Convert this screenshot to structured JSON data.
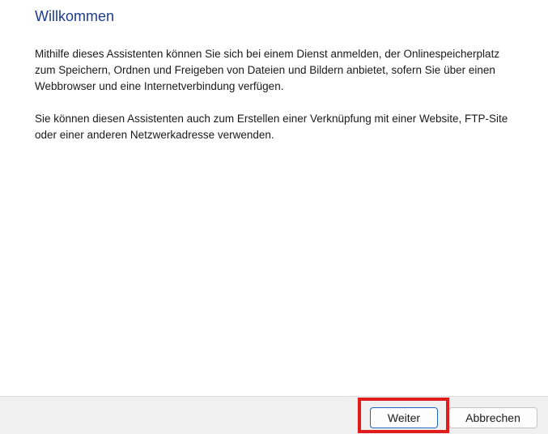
{
  "header": {
    "title": "Willkommen"
  },
  "main": {
    "paragraph1": "Mithilfe dieses Assistenten können Sie sich bei einem Dienst anmelden, der Onlinespeicherplatz zum Speichern, Ordnen und Freigeben von Dateien und Bildern anbietet, sofern Sie über einen Webbrowser und eine Internetverbindung verfügen.",
    "paragraph2": "Sie können diesen Assistenten auch zum Erstellen einer Verknüpfung mit einer Website, FTP-Site oder einer anderen Netzwerkadresse verwenden."
  },
  "footer": {
    "next_label": "Weiter",
    "cancel_label": "Abbrechen"
  },
  "colors": {
    "title": "#1e3c8c",
    "highlight": "#e01b1b",
    "default_button_border": "#1f66c4",
    "footer_background": "#f0f0f0"
  }
}
